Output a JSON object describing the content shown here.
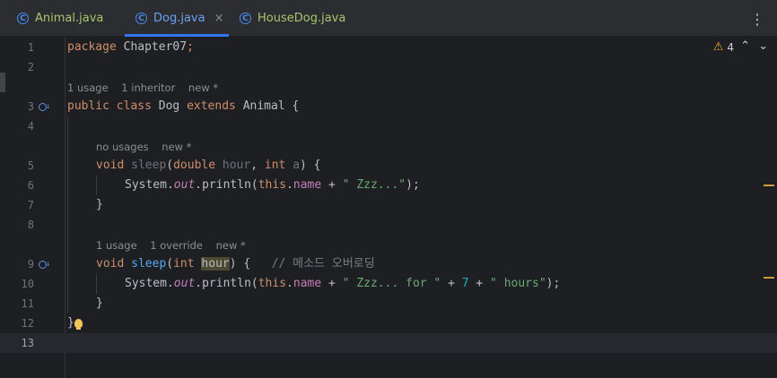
{
  "tabs": [
    {
      "label": "Animal.java",
      "icon": "c-class-icon",
      "active": false
    },
    {
      "label": "Dog.java",
      "icon": "c-class-icon",
      "active": true,
      "close": "×"
    },
    {
      "label": "HouseDog.java",
      "icon": "c-class-icon",
      "active": false
    }
  ],
  "tab_icon_glyph": "C",
  "menu_glyph": "⋮",
  "warnings": {
    "count": "4",
    "up": "⌃",
    "down": "⌄"
  },
  "hints": {
    "class_usage": "1 usage    1 inheritor    new *",
    "sleep1_usage": "no usages    new *",
    "sleep2_usage": "1 usage    1 override    new *"
  },
  "lines": {
    "n1": "1",
    "n2": "2",
    "n3": "3",
    "n4": "4",
    "n5": "5",
    "n6": "6",
    "n7": "7",
    "n8": "8",
    "n9": "9",
    "n10": "10",
    "n11": "11",
    "n12": "12",
    "n13": "13"
  },
  "code": {
    "l1_kw": "package",
    "l1_rest": " Chapter07",
    "l1_semi": ";",
    "l3_kw1": "public",
    "l3_kw2": "class",
    "l3_name": "Dog",
    "l3_kw3": "extends",
    "l3_parent": "Animal",
    "l3_brace": " {",
    "l5_kw": "void",
    "l5_fn": "sleep",
    "l5_open": "(",
    "l5_type1": "double",
    "l5_p1": "hour",
    "l5_comma": ",",
    "l5_type2": "int",
    "l5_p2": "a",
    "l5_close": ") {",
    "l6_sys": "System.",
    "l6_out": "out",
    "l6_println": ".println(",
    "l6_this": "this",
    "l6_dot": ".",
    "l6_name": "name",
    "l6_plus": " + ",
    "l6_str": "\" Zzz...\"",
    "l6_end": ");",
    "l7_brace": "}",
    "l9_kw": "void",
    "l9_fn": "sleep",
    "l9_open": "(",
    "l9_type": "int",
    "l9_p": "hour",
    "l9_close": ") {",
    "l9_comment": "// 메소드 오버로딩",
    "l10_sys": "System.",
    "l10_out": "out",
    "l10_println": ".println(",
    "l10_this": "this",
    "l10_dot": ".",
    "l10_name": "name",
    "l10_plus1": " + ",
    "l10_str1": "\" Zzz... for \"",
    "l10_plus2": " + ",
    "l10_num": "7",
    "l10_plus3": " + ",
    "l10_str2": "\" hours\"",
    "l10_end": ");",
    "l11_brace": "}",
    "l12_brace": "}"
  },
  "colors": {
    "keyword": "#cf8e6d",
    "function": "#56a8f5",
    "field": "#c77dbb",
    "string": "#6aab73",
    "number": "#2aacb8",
    "comment": "#7a7e85",
    "accent": "#3574f0"
  }
}
